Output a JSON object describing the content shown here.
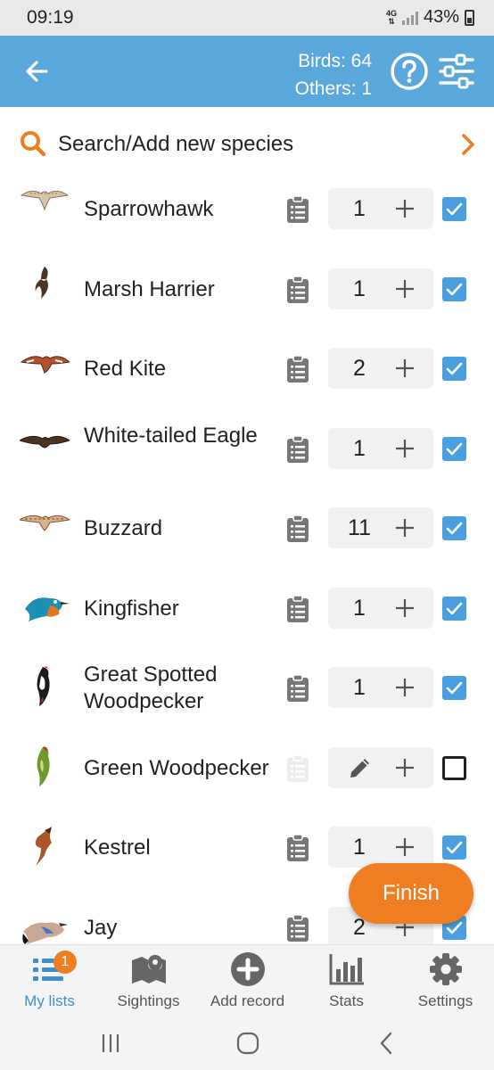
{
  "status_bar": {
    "time": "09:19",
    "network": "4G",
    "battery": "43%"
  },
  "header": {
    "birds_count": "Birds: 64",
    "others_count": "Others: 1"
  },
  "search": {
    "placeholder": "Search/Add new species"
  },
  "species": [
    {
      "name": "Sparrowhawk",
      "count": "1",
      "checked": true,
      "has_notes": true
    },
    {
      "name": "Marsh Harrier",
      "count": "1",
      "checked": true,
      "has_notes": true
    },
    {
      "name": "Red Kite",
      "count": "2",
      "checked": true,
      "has_notes": true
    },
    {
      "name": "White-tailed Eagle",
      "count": "1",
      "checked": true,
      "has_notes": true
    },
    {
      "name": "Buzzard",
      "count": "11",
      "checked": true,
      "has_notes": true
    },
    {
      "name": "Kingfisher",
      "count": "1",
      "checked": true,
      "has_notes": true
    },
    {
      "name": "Great Spotted Woodpecker",
      "count": "1",
      "checked": true,
      "has_notes": true
    },
    {
      "name": "Green Woodpecker",
      "count": "",
      "checked": false,
      "has_notes": false
    },
    {
      "name": "Kestrel",
      "count": "1",
      "checked": true,
      "has_notes": true
    },
    {
      "name": "Jay",
      "count": "2",
      "checked": true,
      "has_notes": true
    }
  ],
  "fab": {
    "label": "Finish"
  },
  "bottom_nav": [
    {
      "label": "My lists",
      "icon": "list-icon",
      "badge": "1",
      "active": true
    },
    {
      "label": "Sightings",
      "icon": "map-icon",
      "active": false
    },
    {
      "label": "Add record",
      "icon": "add-circle-icon",
      "active": false
    },
    {
      "label": "Stats",
      "icon": "bar-chart-icon",
      "active": false
    },
    {
      "label": "Settings",
      "icon": "gear-icon",
      "active": false
    }
  ],
  "colors": {
    "header": "#5aa7dc",
    "accent": "#ef7d22",
    "checkbox": "#4a9fe0"
  }
}
